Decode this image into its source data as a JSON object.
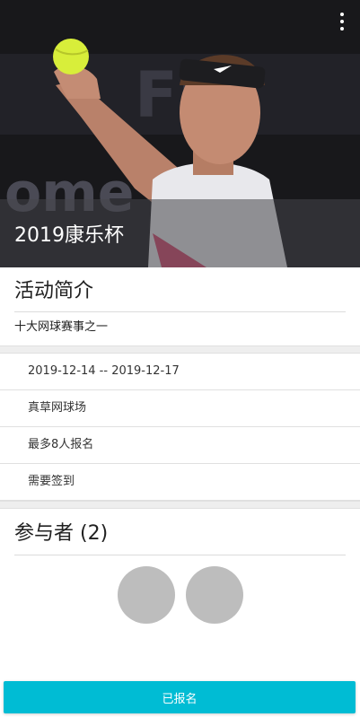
{
  "event": {
    "title": "2019康乐杯"
  },
  "hero": {
    "menu_icon": "more-vert-icon"
  },
  "intro": {
    "heading": "活动简介",
    "description": "十大网球赛事之一"
  },
  "details": [
    {
      "text": "2019-12-14 -- 2019-12-17"
    },
    {
      "text": "真草网球场"
    },
    {
      "text": "最多8人报名"
    },
    {
      "text": "需要签到"
    }
  ],
  "participants": {
    "heading": "参与者 (2)",
    "count": 2
  },
  "action": {
    "label": "已报名"
  },
  "colors": {
    "accent": "#00bcd4",
    "avatar_placeholder": "#bdbdbd",
    "divider": "#e0e0e0"
  }
}
